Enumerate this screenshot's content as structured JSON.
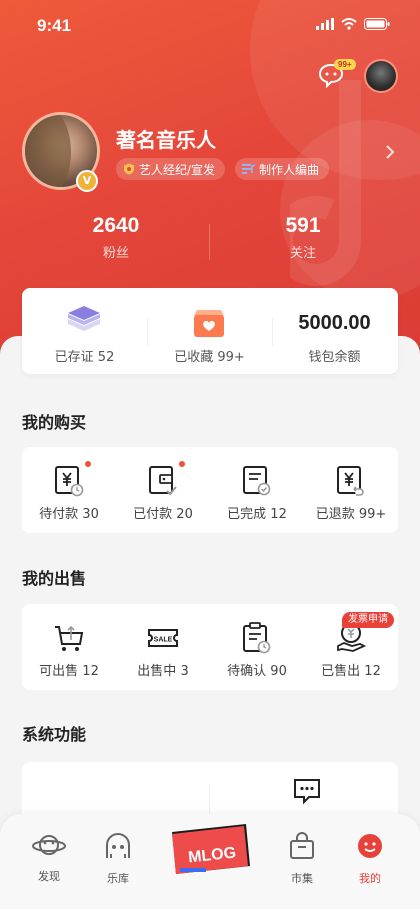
{
  "status_bar": {
    "time": "9:41"
  },
  "header": {
    "message_badge": "99+"
  },
  "profile": {
    "name": "著名音乐人",
    "tags": [
      {
        "label": "艺人经纪/宣发",
        "icon": "shield-icon"
      },
      {
        "label": "制作人编曲",
        "icon": "music-list-icon"
      }
    ],
    "verified_badge": "V"
  },
  "stats": [
    {
      "value": "2640",
      "label": "粉丝"
    },
    {
      "value": "591",
      "label": "关注"
    }
  ],
  "wallet": {
    "items": [
      {
        "label": "已存证",
        "count": "52",
        "icon": "layers-icon"
      },
      {
        "label": "已收藏",
        "count": "99+",
        "icon": "favorites-box-icon"
      },
      {
        "label": "钱包余额",
        "amount": "5000.00"
      }
    ]
  },
  "purchases": {
    "title": "我的购买",
    "items": [
      {
        "label": "待付款",
        "count": "30",
        "icon": "yen-pending-icon",
        "dot": true
      },
      {
        "label": "已付款",
        "count": "20",
        "icon": "wallet-check-icon",
        "dot": true
      },
      {
        "label": "已完成",
        "count": "12",
        "icon": "document-check-icon",
        "dot": false
      },
      {
        "label": "已退款",
        "count": "99+",
        "icon": "yen-refund-icon",
        "dot": false
      }
    ]
  },
  "sales": {
    "title": "我的出售",
    "badge": "发票申请",
    "items": [
      {
        "label": "可出售",
        "count": "12",
        "icon": "cart-upload-icon"
      },
      {
        "label": "出售中",
        "count": "3",
        "icon": "sale-ticket-icon"
      },
      {
        "label": "待确认",
        "count": "90",
        "icon": "clipboard-clock-icon"
      },
      {
        "label": "已售出",
        "count": "12",
        "icon": "coin-hand-icon"
      }
    ]
  },
  "system": {
    "title": "系统功能"
  },
  "tabbar": {
    "tabs": [
      {
        "label": "发现",
        "icon": "planet-icon",
        "active": false
      },
      {
        "label": "乐库",
        "icon": "library-icon",
        "active": false
      },
      {
        "label": "MLOG",
        "icon": "mlog-logo",
        "active": false
      },
      {
        "label": "市集",
        "icon": "shopping-bag-icon",
        "active": false
      },
      {
        "label": "我的",
        "icon": "profile-smile-icon",
        "active": true
      }
    ]
  },
  "colors": {
    "accent": "#e8413a",
    "header": "#e4463a",
    "badge_yellow": "#ffd54a"
  }
}
